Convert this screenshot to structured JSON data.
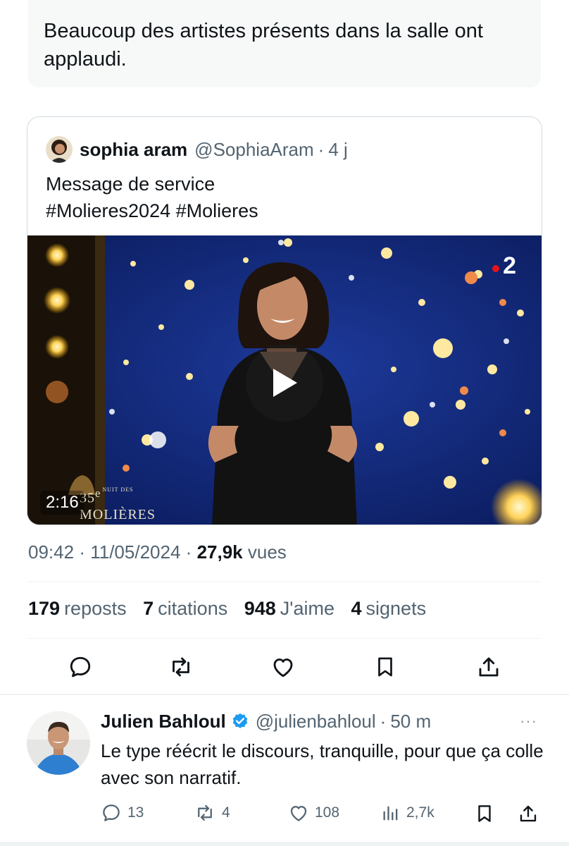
{
  "tweet_text": "Beaucoup des artistes présents dans la salle ont applaudi.",
  "quoted": {
    "author_name": "sophia aram",
    "handle": "@SophiaAram",
    "separator": "·",
    "time": "4 j",
    "text_line1": "Message de service",
    "text_line2": "#Molieres2024 #Molieres",
    "video": {
      "duration": "2:16",
      "watermark_number": "35",
      "watermark_superscript": "e",
      "watermark_small": "NUIT DES",
      "watermark_title": "MOLIÈRES",
      "channel": "2"
    }
  },
  "meta": {
    "time": "09:42",
    "sep1": "·",
    "date": "11/05/2024",
    "sep2": "·",
    "views_count": "27,9k",
    "views_label": "vues"
  },
  "stats": {
    "reposts_count": "179",
    "reposts_label": "reposts",
    "quotes_count": "7",
    "quotes_label": "citations",
    "likes_count": "948",
    "likes_label": "J'aime",
    "bookmarks_count": "4",
    "bookmarks_label": "signets"
  },
  "reply": {
    "author_name": "Julien Bahloul",
    "verified": true,
    "handle": "@julienbahloul",
    "separator": "·",
    "time": "50 m",
    "more": "···",
    "text": "Le type réécrit le discours, tranquille, pour que ça colle avec son narratif.",
    "replies": "13",
    "reposts": "4",
    "likes": "108",
    "views": "2,7k"
  },
  "colors": {
    "secondary_text": "#536471",
    "verified_blue": "#1d9bf0",
    "icon": "#0f1419"
  },
  "icons": [
    "reply-icon",
    "repost-icon",
    "like-icon",
    "bookmark-icon",
    "share-icon",
    "views-icon",
    "verified-icon",
    "play-icon",
    "more-icon"
  ]
}
